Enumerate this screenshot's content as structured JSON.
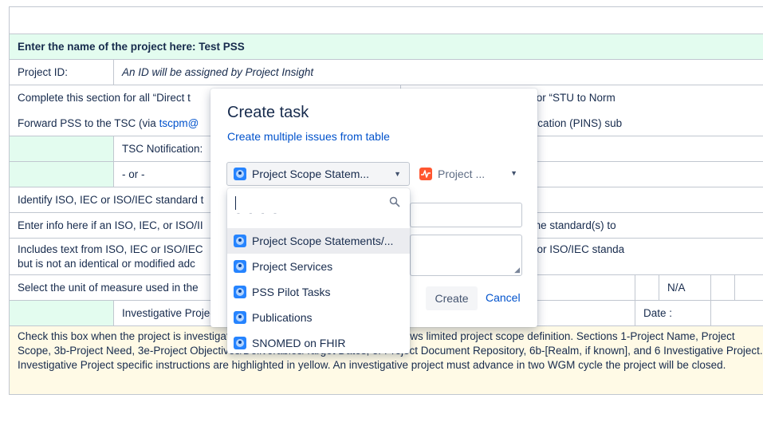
{
  "doc": {
    "project_name_label": "Enter the name of the project here: Test PSS",
    "project_id_label": "Project ID:",
    "project_id_value": "An ID will be assigned by Project Insight",
    "complete_section_left": "Complete this section for all “Direct t",
    "complete_section_right": "“Informative to Normative” or “STU to Norm",
    "forward_pss_prefix": "Forward PSS to the TSC (via ",
    "forward_pss_link": "tscpm@",
    "forward_pss_right": "NSI) Project Initiation Notification (PINS) sub",
    "tsc_notification_label": "TSC Notification:",
    "or_label": "- or -",
    "identify_iso_label": "Identify ISO, IEC or ISO/IEC standard t",
    "enter_info_left": "Enter info here if an ISO, IEC, or ISO/II",
    "enter_info_right": "; Enter the designation of the standard(s) to",
    "includes_text_line1": "Includes text from ISO, IEC or ISO/IEC",
    "includes_text_line2": "but is not an identical or modified adc",
    "includes_text_right": "rom one or more ISO, IEC or ISO/IEC standa",
    "unit_measure_label": "Select the unit of measure used in the",
    "na_label": "N/A",
    "investigative_label": "Investigative Project",
    "date_label": "Date :",
    "check_box_text": "Check this box when the project is investigative or exploratory in nature, which allows limited project scope definition. Sections 1-Project Name, Project Scope, 3b-Project Need, 3e-Project Objectives/Deliverables/Target Dates, 3i-Project Document Repository, 6b-[Realm, if known], and 6 Investigative Project. Investigative Project specific instructions are highlighted in yellow. An investigative project must advance in two WGM cycle the project will be closed."
  },
  "dialog": {
    "title": "Create task",
    "multiple_link": "Create multiple issues from table",
    "project_select_value": "Project Scope Statem...",
    "issue_type_value": "Project ...",
    "create_button": "Create",
    "cancel_button": "Cancel"
  },
  "dropdown": {
    "search_value": "",
    "partial_text": "- - - -",
    "items": [
      {
        "label": "Project Scope Statements/..."
      },
      {
        "label": "Project Services"
      },
      {
        "label": "PSS Pilot Tasks"
      },
      {
        "label": "Publications"
      },
      {
        "label": "SNOMED on FHIR"
      }
    ]
  },
  "colors": {
    "link": "#0052cc",
    "header_green": "#e3fcef",
    "highlight_yellow": "#fffae6",
    "issue_type_icon": "#ff5630",
    "project_icon": "#2684ff"
  }
}
